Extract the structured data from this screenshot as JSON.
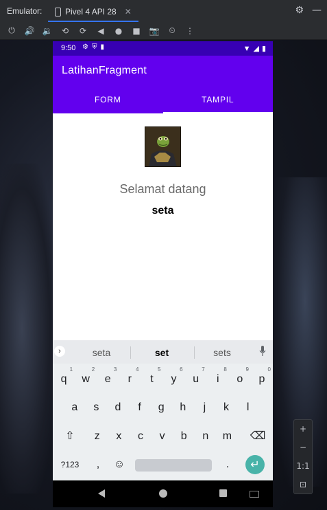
{
  "emulator": {
    "label": "Emulator:",
    "device_tab": "Pivel 4 API 28",
    "toolbar_icons": [
      "power-icon",
      "volume-up-icon",
      "volume-down-icon",
      "rotate-left-icon",
      "rotate-right-icon",
      "back-icon",
      "home-icon",
      "overview-icon",
      "camera-icon",
      "snapshot-icon",
      "more-icon"
    ],
    "zoom_panel": {
      "zoom_in": "+",
      "zoom_out": "−",
      "actual_size": "1:1"
    }
  },
  "phone": {
    "status_time": "9:50",
    "app_title": "LatihanFragment",
    "tabs": [
      {
        "label": "FORM",
        "active": false
      },
      {
        "label": "TAMPIL",
        "active": true
      }
    ],
    "welcome_text": "Selamat datang",
    "user_name": "seta"
  },
  "keyboard": {
    "suggestions": [
      "seta",
      "set",
      "sets"
    ],
    "row1": [
      {
        "k": "q",
        "h": "1"
      },
      {
        "k": "w",
        "h": "2"
      },
      {
        "k": "e",
        "h": "3"
      },
      {
        "k": "r",
        "h": "4"
      },
      {
        "k": "t",
        "h": "5"
      },
      {
        "k": "y",
        "h": "6"
      },
      {
        "k": "u",
        "h": "7"
      },
      {
        "k": "i",
        "h": "8"
      },
      {
        "k": "o",
        "h": "9"
      },
      {
        "k": "p",
        "h": "0"
      }
    ],
    "row2": [
      "a",
      "s",
      "d",
      "f",
      "g",
      "h",
      "j",
      "k",
      "l"
    ],
    "row3": [
      "z",
      "x",
      "c",
      "v",
      "b",
      "n",
      "m"
    ],
    "symbols_label": "?123",
    "comma": ",",
    "period": "."
  },
  "colors": {
    "status_bar": "#3700b3",
    "app_bar": "#6200ee",
    "enter_key": "#48b3a9"
  }
}
